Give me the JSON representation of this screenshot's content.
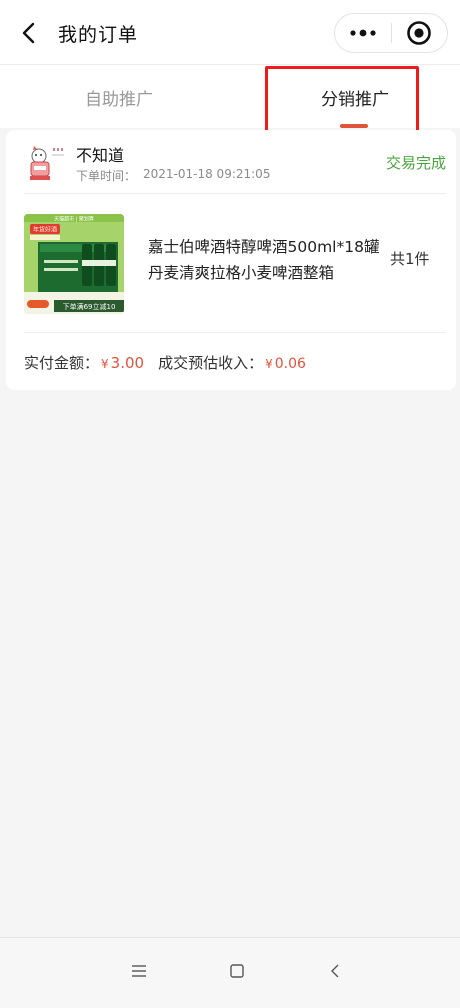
{
  "header": {
    "title": "我的订单",
    "back_icon": "back-arrow-icon",
    "more_icon": "more-dots-icon",
    "target_icon": "target-icon"
  },
  "tabs": [
    {
      "label": "自助推广",
      "active": false
    },
    {
      "label": "分销推广",
      "active": true
    }
  ],
  "colors": {
    "accent": "#e0533b",
    "status_green": "#49a33e",
    "highlight_red": "#ee1b1b"
  },
  "order": {
    "shop_name": "不知道",
    "time_label": "下单时间：",
    "time": "2021-01-18 09:21:05",
    "status": "交易完成",
    "product": {
      "name": "嘉士伯啤酒特醇啤酒500ml*18罐丹麦清爽拉格小麦啤酒整箱",
      "quantity": "共1件",
      "image_banner": "下单满69立减10",
      "image_top_text": "天猫超市 | 聚划算",
      "image_badge": "年货好酒"
    },
    "paid_label": "实付金额：",
    "paid_currency": "¥",
    "paid_amount": "3.00",
    "income_label": "成交预估收入：",
    "income_currency": "¥",
    "income_amount": "0.06"
  },
  "navbar": {
    "menu_icon": "menu-lines-icon",
    "home_icon": "square-home-icon",
    "back_icon": "nav-back-icon"
  }
}
